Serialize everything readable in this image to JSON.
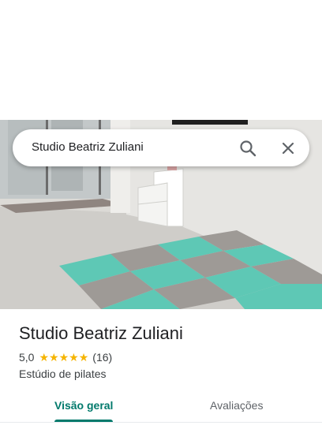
{
  "search": {
    "value": "Studio Beatriz Zuliani",
    "search_icon": "search-icon",
    "close_icon": "close-icon"
  },
  "place": {
    "name": "Studio Beatriz Zuliani",
    "rating": "5,0",
    "stars": 5,
    "review_count": "(16)",
    "category": "Estúdio de pilates"
  },
  "tabs": [
    {
      "label": "Visão geral",
      "active": true
    },
    {
      "label": "Avaliações",
      "active": false
    }
  ],
  "colors": {
    "accent": "#00796b",
    "star": "#f5b400",
    "mat_teal": "#5ec8b5",
    "mat_gray": "#9e9a96"
  }
}
